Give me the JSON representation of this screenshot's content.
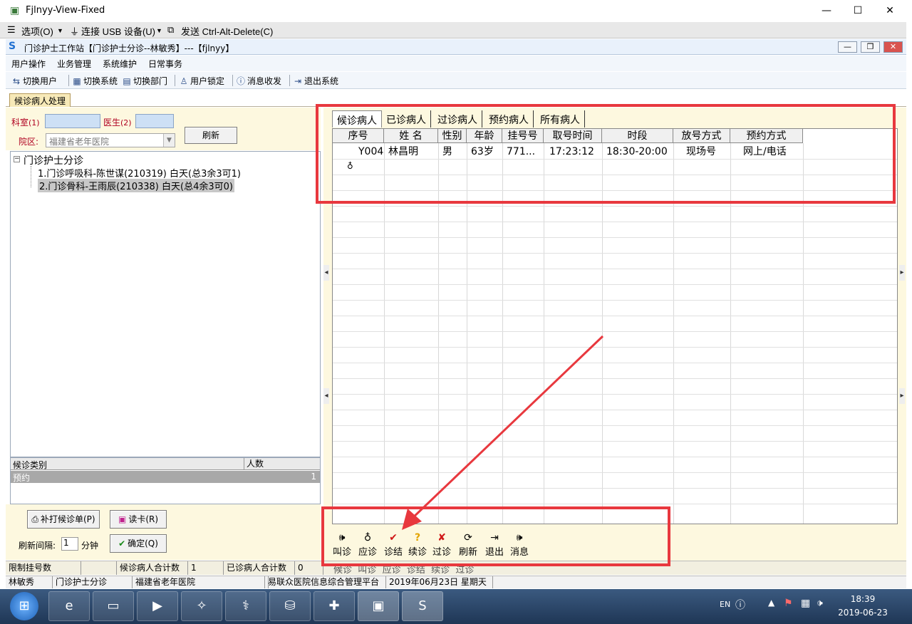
{
  "window": {
    "title": "Fjlnyy-View-Fixed",
    "minimize": "—",
    "maximize": "☐",
    "close": "✕"
  },
  "vnc_bar": {
    "options": "选项(O)",
    "usb": "连接 USB 设备(U)",
    "cad": "发送 Ctrl-Alt-Delete(C)"
  },
  "app": {
    "title": "门诊护士工作站【门诊护士分诊--林敏秀】---【fjlnyy】"
  },
  "menu": [
    "用户操作",
    "业务管理",
    "系统维护",
    "日常事务"
  ],
  "toolbar": [
    "切换用户",
    "切换系统",
    "切换部门",
    "用户锁定",
    "消息收发",
    "退出系统"
  ],
  "tab_main": "候诊病人处理",
  "left": {
    "dept_label": "科室",
    "dept_key": "(1)",
    "doctor_label": "医生",
    "doctor_key": "(2)",
    "campus_label": "院区:",
    "campus_value": "福建省老年医院",
    "refresh": "刷新",
    "tree_root": "门诊护士分诊",
    "tree_items": [
      "1.门诊呼吸科-陈世谋(210319) 白天(总3余3可1)",
      "2.门诊骨科-王雨辰(210338) 白天(总4余3可0)"
    ],
    "cat_header": [
      "候诊类别",
      "人数"
    ],
    "cat_row": [
      "预约",
      "1"
    ],
    "reprint": "补打候诊单(P)",
    "read_card": "读卡(R)",
    "interval_label": "刷新间隔:",
    "interval_value": "1",
    "interval_unit": "分钟",
    "confirm": "确定(Q)"
  },
  "right": {
    "tabs": [
      "候诊病人",
      "已诊病人",
      "过诊病人",
      "预约病人",
      "所有病人"
    ],
    "columns": [
      "序号",
      "姓  名",
      "性别",
      "年龄",
      "挂号号",
      "取号时间",
      "时段",
      "放号方式",
      "预约方式"
    ],
    "rows": [
      [
        "Y004",
        "林昌明",
        "男",
        "63岁",
        "771...",
        "17:23:12",
        "18:30-20:00",
        "现场号",
        "网上/电话"
      ]
    ],
    "actions": [
      "叫诊",
      "应诊",
      "诊结",
      "续诊",
      "过诊",
      "刷新",
      "退出",
      "消息"
    ],
    "under_actions": [
      "候诊",
      "叫诊",
      "应诊",
      "诊结",
      "续诊",
      "过诊"
    ]
  },
  "status1": [
    "限制挂号数",
    "",
    "候诊病人合计数",
    "1",
    "已诊病人合计数",
    "0"
  ],
  "status2": [
    "林敏秀",
    "门诊护士分诊",
    "福建省老年医院",
    "",
    "易联众医院信息综合管理平台",
    "2019年06月23日 星期天"
  ],
  "taskbar": {
    "time": "18:39",
    "date": "2019-06-23",
    "lang": "EN"
  },
  "colors": {
    "annotation": "#e8383e",
    "panel": "#fdf8df",
    "input_blue": "#cde0f5"
  }
}
